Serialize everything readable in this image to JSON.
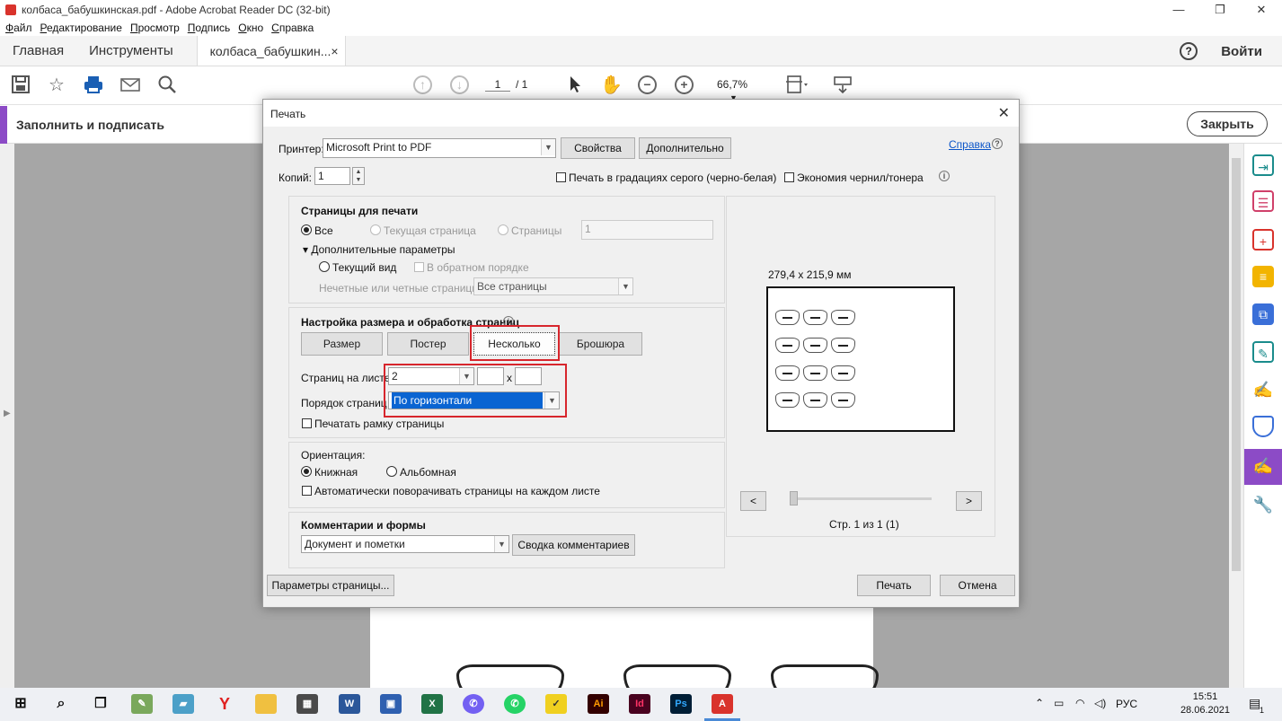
{
  "window": {
    "title": "колбаса_бабушкинская.pdf - Adobe Acrobat Reader DC (32-bit)",
    "minimize": "—",
    "maximize": "❐",
    "close": "✕"
  },
  "menu": [
    "Файл",
    "Редактирование",
    "Просмотр",
    "Подпись",
    "Окно",
    "Справка"
  ],
  "tabs": {
    "home": "Главная",
    "tools": "Инструменты",
    "doc": "колбаса_бабушкин...",
    "doc_close": "×",
    "help": "?",
    "signin": "Войти"
  },
  "toolbar": {
    "page_current": "1",
    "page_total": "/ 1",
    "zoom": "66,7%"
  },
  "fillsign": {
    "label": "Заполнить и подписать",
    "close": "Закрыть"
  },
  "dialog": {
    "title": "Печать",
    "close": "✕",
    "printer_label": "Принтер:",
    "printer_value": "Microsoft Print to PDF",
    "properties": "Свойства",
    "advanced": "Дополнительно",
    "help_link": "Справка",
    "copies_label": "Копий:",
    "copies_value": "1",
    "grayscale": "Печать в градациях серого (черно-белая)",
    "ink_saver": "Экономия чернил/тонера",
    "pages": {
      "title": "Страницы для печати",
      "all": "Все",
      "current_page": "Текущая страница",
      "pages": "Страницы",
      "pages_value": "1",
      "more_options": "▾ Дополнительные параметры",
      "current_view": "Текущий вид",
      "reverse": "В обратном порядке",
      "odd_even_label": "Нечетные или четные страницы:",
      "odd_even_value": "Все страницы"
    },
    "sizing": {
      "title": "Настройка размера и обработка страниц",
      "size": "Размер",
      "poster": "Постер",
      "multiple": "Несколько",
      "booklet": "Брошюра",
      "pages_per_sheet_label": "Страниц на листе",
      "pages_per_sheet_value": "2",
      "x_label": "x",
      "order_label": "Порядок страниц",
      "order_value": "По горизонтали",
      "print_border": "Печатать рамку страницы"
    },
    "orientation": {
      "title": "Ориентация:",
      "portrait": "Книжная",
      "landscape": "Альбомная",
      "auto_rotate": "Автоматически поворачивать страницы на каждом листе"
    },
    "comments": {
      "title": "Комментарии и формы",
      "value": "Документ и пометки",
      "summary": "Сводка комментариев"
    },
    "preview": {
      "size": "279,4 x 215,9 мм",
      "prev": "<",
      "next": ">",
      "page_info": "Стр. 1 из 1 (1)"
    },
    "page_setup": "Параметры страницы...",
    "print": "Печать",
    "cancel": "Отмена"
  },
  "taskbar": {
    "lang": "РУС",
    "time": "15:51",
    "date": "28.06.2021",
    "notifications": "1"
  },
  "colors": {
    "accent": "#8c4bc6",
    "highlight": "#d7262d",
    "selection": "#0a64d2",
    "acrobat_red": "#d9332c"
  }
}
